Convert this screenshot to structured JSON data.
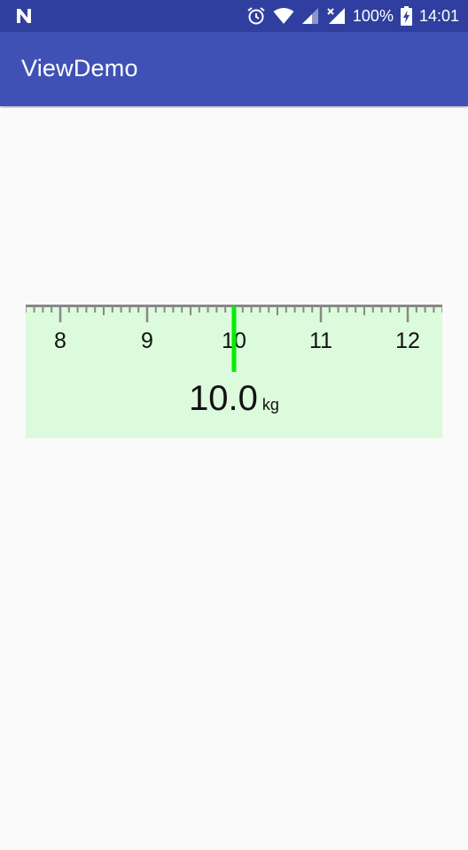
{
  "status_bar": {
    "battery_text": "100%",
    "time": "14:01",
    "background": "#303f9f",
    "icons": [
      "notification-n-icon",
      "alarm-icon",
      "wifi-icon",
      "signal-icon",
      "no-signal-icon",
      "battery-charging-icon"
    ]
  },
  "app_bar": {
    "title": "ViewDemo",
    "background": "#3f51b5"
  },
  "ruler": {
    "labels": [
      "8",
      "9",
      "10",
      "11",
      "12"
    ],
    "min_visible": 7.6,
    "max_visible": 12.4,
    "minor_step": 0.1,
    "current_value": 10.0,
    "background": "#dcfadc",
    "tick_color": "#888888",
    "indicator_color": "#00ee00"
  },
  "readout": {
    "value": "10.0",
    "unit": "kg"
  }
}
